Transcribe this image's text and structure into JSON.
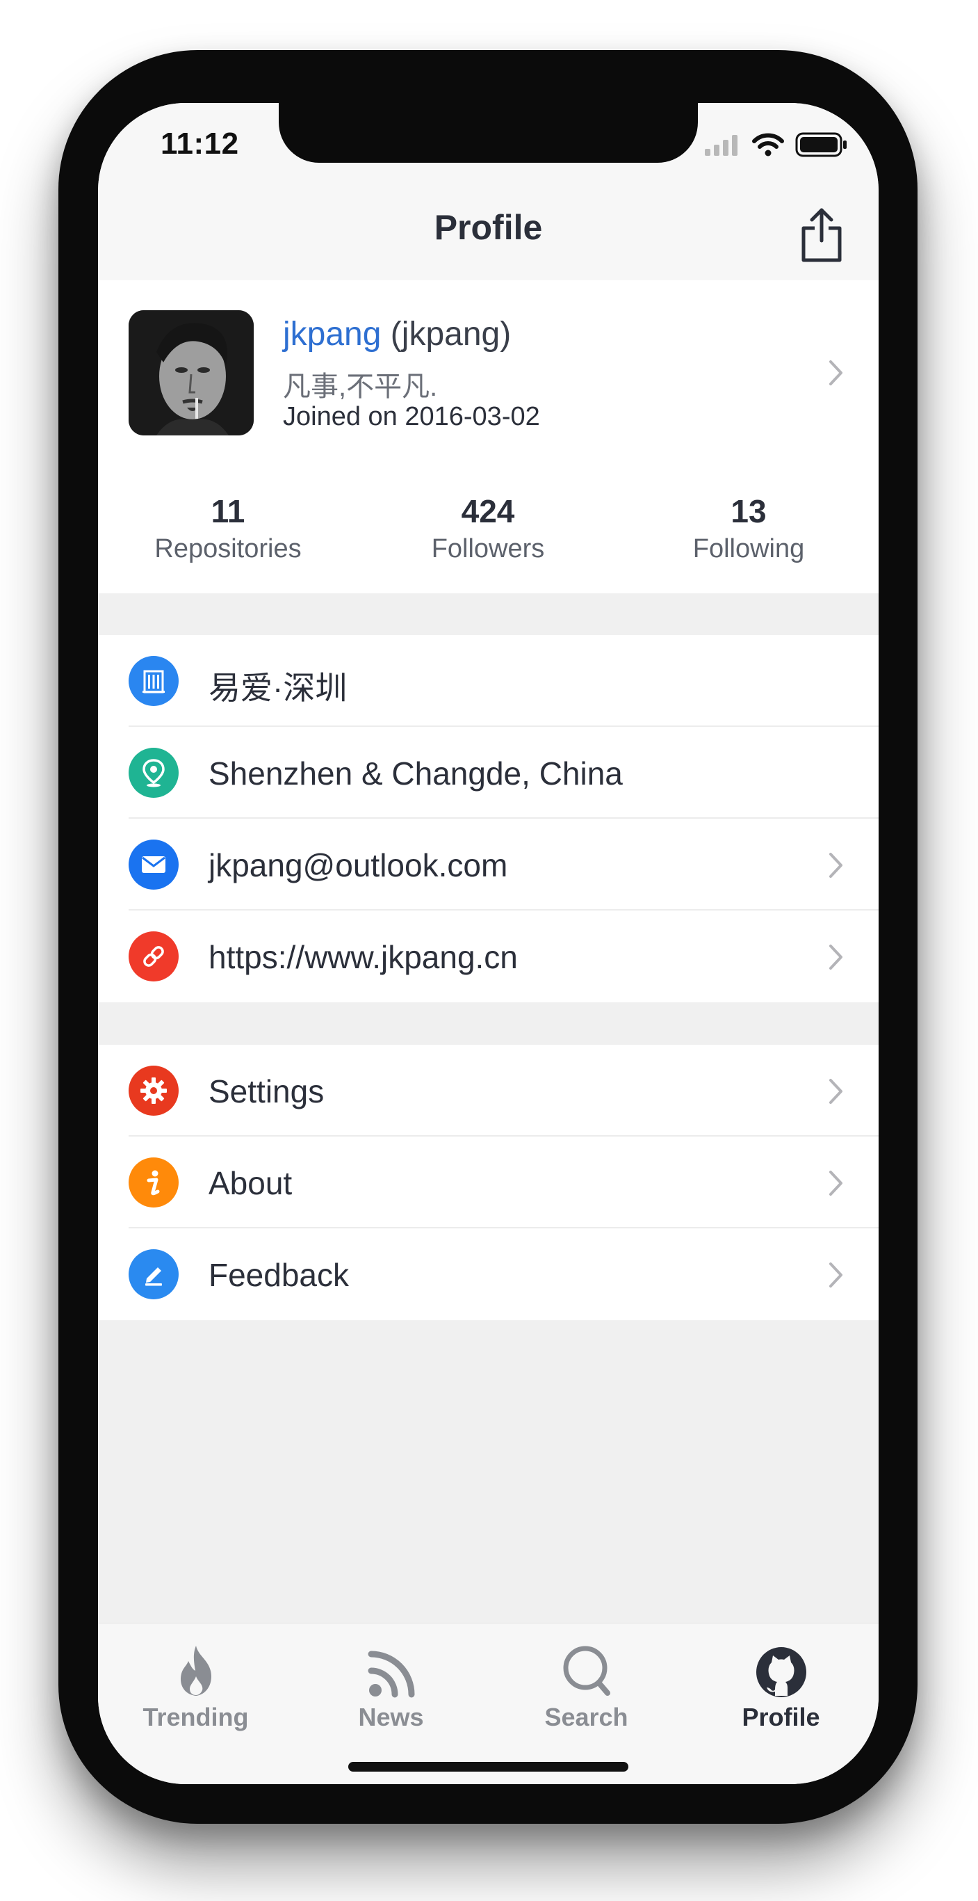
{
  "status_bar": {
    "time": "11:12"
  },
  "nav": {
    "title": "Profile"
  },
  "profile": {
    "login_link": "jkpang",
    "username_suffix": " (jkpang)",
    "bio": "凡事,不平凡.",
    "joined": "Joined on 2016-03-02",
    "stats": [
      {
        "value": "11",
        "label": "Repositories"
      },
      {
        "value": "424",
        "label": "Followers"
      },
      {
        "value": "13",
        "label": "Following"
      }
    ]
  },
  "info_rows": [
    {
      "label": "易爱·深圳",
      "icon": "company-icon",
      "color": "#2a86f0",
      "chevron": false
    },
    {
      "label": "Shenzhen & Changde, China",
      "icon": "location-icon",
      "color": "#1fb493",
      "chevron": false
    },
    {
      "label": "jkpang@outlook.com",
      "icon": "email-icon",
      "color": "#1a73f0",
      "chevron": true
    },
    {
      "label": "https://www.jkpang.cn",
      "icon": "link-icon",
      "color": "#f03a2a",
      "chevron": true
    }
  ],
  "menu_rows": [
    {
      "label": "Settings",
      "icon": "settings-icon",
      "color": "#e8391f",
      "chevron": true
    },
    {
      "label": "About",
      "icon": "info-icon",
      "color": "#ff8a0a",
      "chevron": true
    },
    {
      "label": "Feedback",
      "icon": "edit-icon",
      "color": "#2a8af0",
      "chevron": true
    }
  ],
  "tab_bar": [
    {
      "label": "Trending",
      "icon": "flame-icon",
      "active": false
    },
    {
      "label": "News",
      "icon": "rss-icon",
      "active": false
    },
    {
      "label": "Search",
      "icon": "search-icon",
      "active": false
    },
    {
      "label": "Profile",
      "icon": "github-icon",
      "active": true
    }
  ],
  "colors": {
    "link_blue": "#2e6fd1",
    "text_dark": "#2b2f3a",
    "tab_inactive": "#8a8d93"
  }
}
